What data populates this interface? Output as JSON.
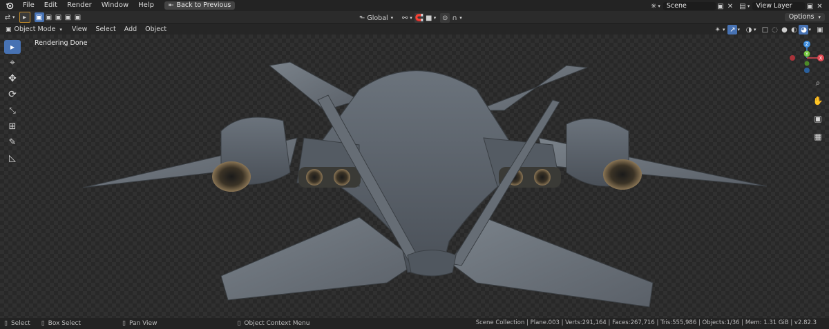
{
  "topbar": {
    "menus": [
      "File",
      "Edit",
      "Render",
      "Window",
      "Help"
    ],
    "back_button": "Back to Previous",
    "scene_label": "Scene",
    "view_layer_label": "View Layer"
  },
  "toolbar": {
    "transform_orientation": "Global",
    "options_label": "Options"
  },
  "header": {
    "mode": "Object Mode",
    "menus": [
      "View",
      "Select",
      "Add",
      "Object"
    ]
  },
  "viewport": {
    "status_text": "Rendering Done",
    "gizmo": {
      "z": "Z",
      "x": "X",
      "y": "Y"
    }
  },
  "statusbar": {
    "select": "Select",
    "box_select": "Box Select",
    "pan_view": "Pan View",
    "context_menu": "Object Context Menu",
    "stats": "Scene Collection | Plane.003 | Verts:291,164 | Faces:267,716 | Tris:555,986 | Objects:1/36 | Mem: 1.31 GiB | v2.82.3"
  },
  "colors": {
    "accent": "#4772b3",
    "axis_x": "#e14b54",
    "axis_y": "#72c43a",
    "axis_z": "#3e8ee0"
  }
}
